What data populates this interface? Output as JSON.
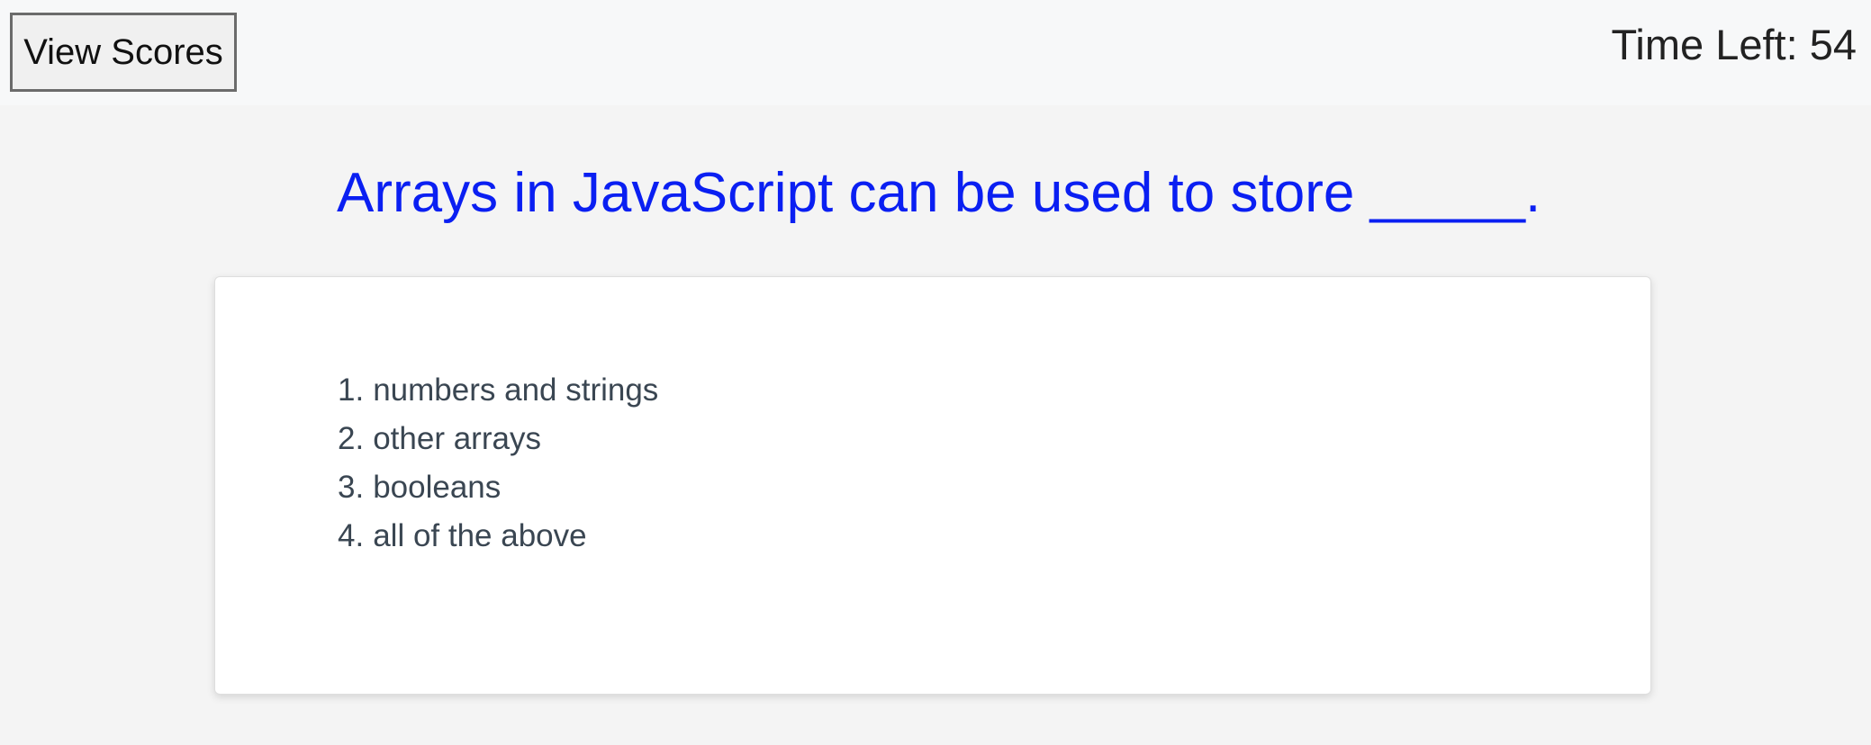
{
  "header": {
    "view_scores_label": "View Scores",
    "timer_label": "Time Left:",
    "timer_value": "54"
  },
  "question": {
    "text": "Arrays in JavaScript can be used to store _____."
  },
  "answers": [
    {
      "number": "1.",
      "text": "numbers and strings"
    },
    {
      "number": "2.",
      "text": "other arrays"
    },
    {
      "number": "3.",
      "text": "booleans"
    },
    {
      "number": "4.",
      "text": "all of the above"
    }
  ]
}
